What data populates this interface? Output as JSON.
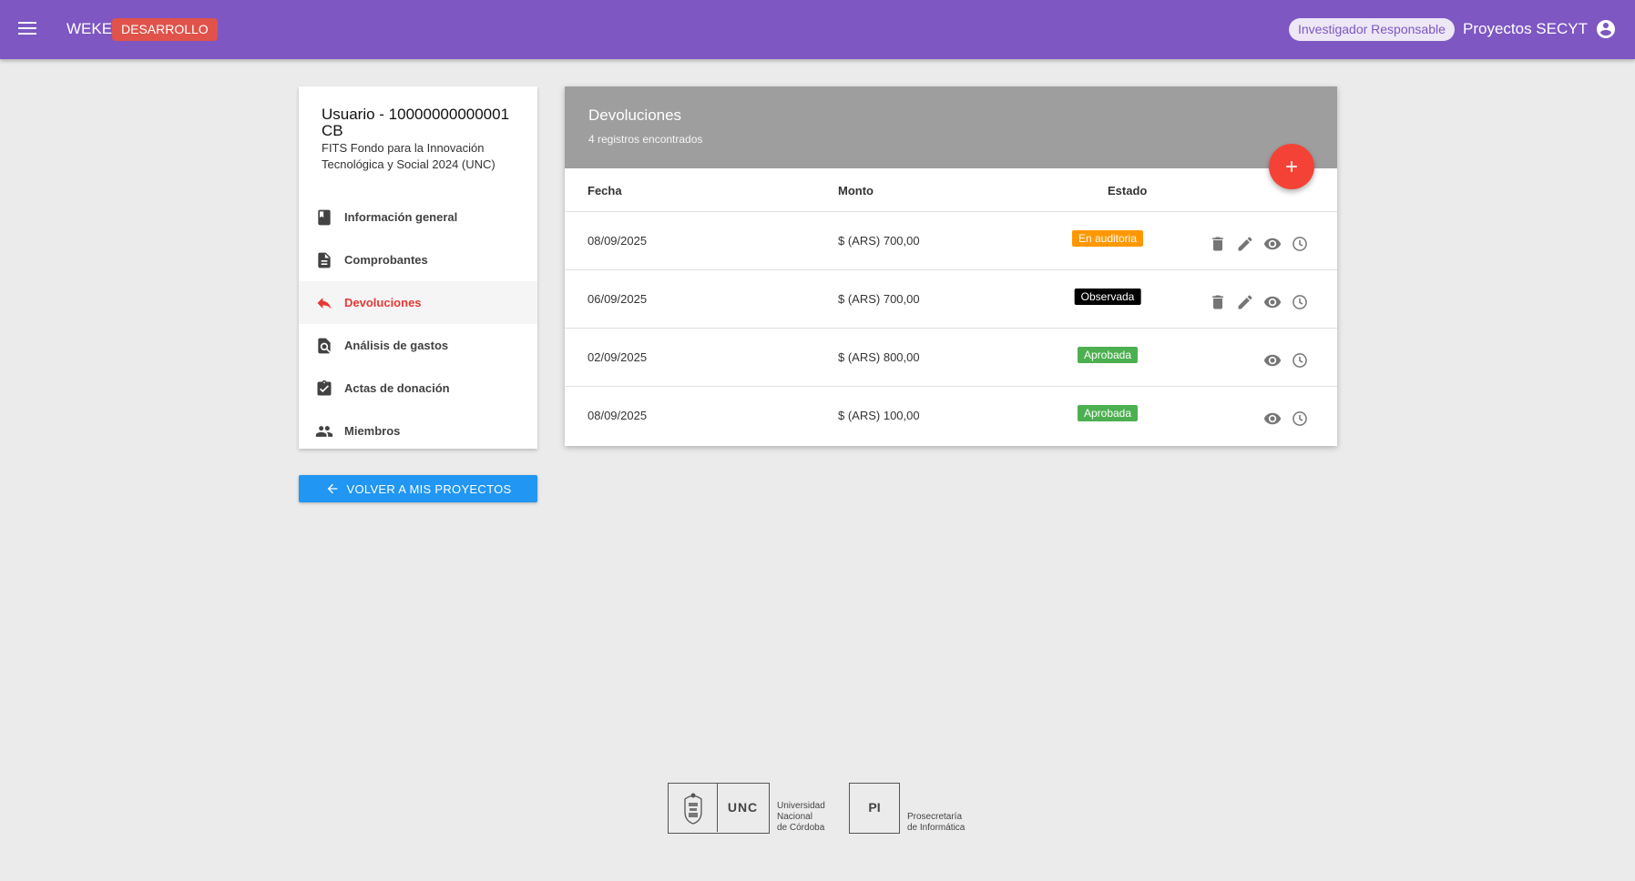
{
  "header": {
    "app_name": "WEKE",
    "environment": "DESARROLLO",
    "role": "Investigador Responsable",
    "title": "Proyectos SECYT",
    "menu_icon": "menu-icon",
    "account_icon": "account-circle-icon",
    "colors": {
      "bar": "#7e57c2",
      "env_badge": "#e0524a"
    }
  },
  "sidebar": {
    "user": "Usuario - 10000000000001CB",
    "project": "FITS Fondo para la Innovación Tecnológica y Social 2024 (UNC)",
    "items": [
      {
        "label": "Información general",
        "icon": "book-icon",
        "active": false
      },
      {
        "label": "Comprobantes",
        "icon": "description-icon",
        "active": false
      },
      {
        "label": "Devoluciones",
        "icon": "reply-icon",
        "active": true
      },
      {
        "label": "Análisis de gastos",
        "icon": "find-in-page-icon",
        "active": false
      },
      {
        "label": "Actas de donación",
        "icon": "assignment-check-icon",
        "active": false
      },
      {
        "label": "Miembros",
        "icon": "people-icon",
        "active": false
      }
    ],
    "back_button": "VOLVER A MIS PROYECTOS"
  },
  "main": {
    "title": "Devoluciones",
    "subtitle": "4 registros encontrados",
    "columns": [
      "Fecha",
      "Monto",
      "Estado"
    ],
    "rows": [
      {
        "fecha": "08/09/2025",
        "monto": "$ (ARS) 700,00",
        "estado": "En auditoria",
        "estado_color": "#ff9800",
        "actions": [
          "delete-icon",
          "edit-icon",
          "view-icon",
          "history-icon"
        ]
      },
      {
        "fecha": "06/09/2025",
        "monto": "$ (ARS) 700,00",
        "estado": "Observada",
        "estado_color": "#000000",
        "actions": [
          "delete-icon",
          "edit-icon",
          "view-icon",
          "history-icon"
        ]
      },
      {
        "fecha": "02/09/2025",
        "monto": "$ (ARS) 800,00",
        "estado": "Aprobada",
        "estado_color": "#4caf50",
        "actions": [
          "view-icon",
          "history-icon"
        ]
      },
      {
        "fecha": "08/09/2025",
        "monto": "$ (ARS) 100,00",
        "estado": "Aprobada",
        "estado_color": "#4caf50",
        "actions": [
          "view-icon",
          "history-icon"
        ]
      }
    ]
  },
  "footer": {
    "unc_abbr": "UNC",
    "unc_name": [
      "Universidad",
      "Nacional",
      "de Córdoba"
    ],
    "pi_abbr": "PI",
    "pi_name": [
      "Prosecretaría",
      "de Informática"
    ]
  }
}
